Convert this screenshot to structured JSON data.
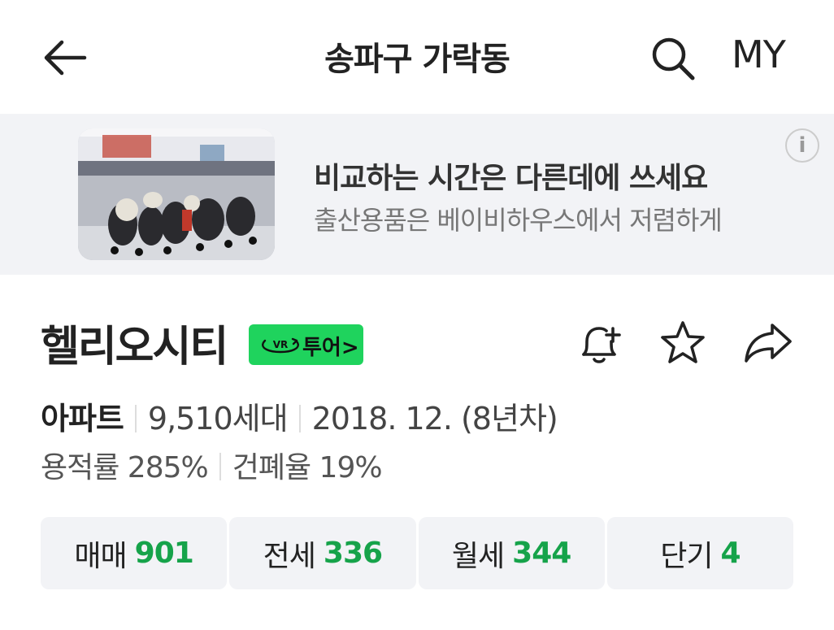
{
  "header": {
    "title": "송파구 가락동",
    "my_label": "MY"
  },
  "ad": {
    "title": "비교하는 시간은 다른데에 쓰세요",
    "subtitle": "출산용품은 베이비하우스에서 저렴하게",
    "info_label": "i"
  },
  "complex": {
    "name": "헬리오시티",
    "vr_badge": "VR",
    "vr_label": "투어>",
    "type": "아파트",
    "households": "9,510세대",
    "built": "2018. 12. (8년차)",
    "far": "용적률 285%",
    "bcr": "건폐율 19%"
  },
  "tabs": [
    {
      "label": "매매",
      "count": "901"
    },
    {
      "label": "전세",
      "count": "336"
    },
    {
      "label": "월세",
      "count": "344"
    },
    {
      "label": "단기",
      "count": "4"
    }
  ],
  "colors": {
    "accent_green": "#16a34a",
    "vr_badge": "#1fd35d",
    "ad_background": "#f2f3f6"
  }
}
